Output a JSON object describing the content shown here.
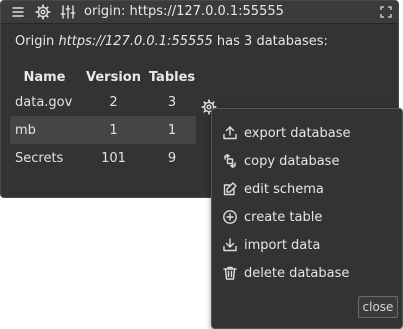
{
  "window": {
    "title": "origin: https://127.0.0.1:55555",
    "icons": [
      "menu-icon",
      "gear-icon",
      "sliders-icon",
      "fullscreen-icon"
    ]
  },
  "summary": {
    "prefix": "Origin ",
    "origin": "https://127.0.0.1:55555",
    "suffix": " has 3 databases:"
  },
  "table": {
    "headers": [
      "Name",
      "Version",
      "Tables"
    ],
    "rows": [
      {
        "name": "data.gov",
        "version": "2",
        "tables": "3"
      },
      {
        "name": "mb",
        "version": "1",
        "tables": "1"
      },
      {
        "name": "Secrets",
        "version": "101",
        "tables": "9"
      }
    ]
  },
  "menu": {
    "items": [
      {
        "label": "export database",
        "icon": "export-icon"
      },
      {
        "label": "copy database",
        "icon": "copy-icon"
      },
      {
        "label": "edit schema",
        "icon": "edit-icon"
      },
      {
        "label": "create table",
        "icon": "plus-circle-icon"
      },
      {
        "label": "import data",
        "icon": "import-icon"
      },
      {
        "label": "delete database",
        "icon": "trash-icon"
      }
    ],
    "close_label": "close"
  }
}
